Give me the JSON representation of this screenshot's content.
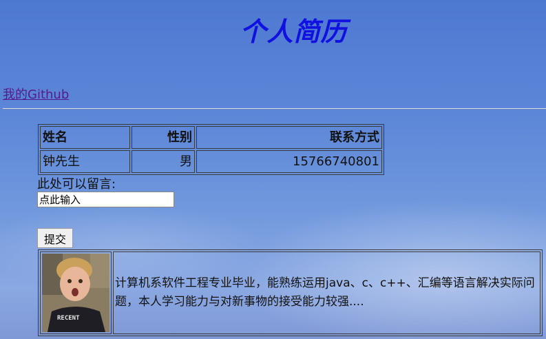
{
  "page": {
    "title": "个人简历"
  },
  "nav": {
    "github_link": "我的Github"
  },
  "info_table": {
    "headers": [
      "姓名",
      "性别",
      "联系方式"
    ],
    "rows": [
      [
        "钟先生",
        "男",
        "15766740801"
      ]
    ]
  },
  "message": {
    "label": "此处可以留言:",
    "placeholder": "点此输入",
    "submit_label": "提交"
  },
  "profile": {
    "photo_caption": "RECENT",
    "bio": "计算机系软件工程专业毕业，能熟练运用java、c、c++、汇编等语言解决实际问题，本人学习能力与对新事物的接受能力较强...."
  }
}
